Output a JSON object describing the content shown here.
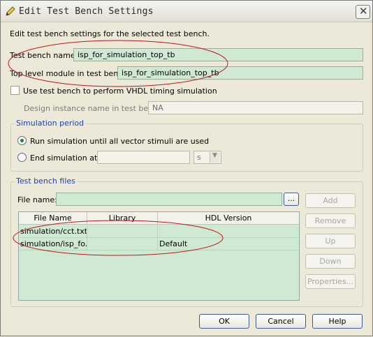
{
  "window": {
    "title": "Edit Test Bench Settings",
    "close_glyph": "✕"
  },
  "description": "Edit test bench settings for the selected test bench.",
  "test_bench_name": {
    "label": "Test bench name:",
    "value": "isp_for_simulation_top_tb"
  },
  "top_level_module": {
    "label": "Top level module in test bench:",
    "value": "isp_for_simulation_top_tb"
  },
  "vhdl_timing": {
    "label": "Use test bench to perform VHDL timing simulation",
    "checked": false
  },
  "design_instance": {
    "label": "Design instance name in test bench:",
    "value": "NA"
  },
  "simulation_period": {
    "title": "Simulation period",
    "run_all_label": "Run simulation until all vector stimuli are used",
    "end_at_label": "End simulation at:",
    "end_at_value": "",
    "unit_value": "s",
    "selected": "run_all"
  },
  "test_bench_files": {
    "title": "Test bench files",
    "file_name_label": "File name:",
    "file_name_value": "",
    "browse_label": "...",
    "columns": [
      "File Name",
      "Library",
      "HDL Version"
    ],
    "rows": [
      {
        "file": "simulation/cct.txt",
        "library": "",
        "hdl": ""
      },
      {
        "file": "simulation/isp_fo...",
        "library": "",
        "hdl": "Default"
      }
    ],
    "buttons": {
      "add": "Add",
      "remove": "Remove",
      "up": "Up",
      "down": "Down",
      "properties": "Properties..."
    }
  },
  "footer": {
    "ok": "OK",
    "cancel": "Cancel",
    "help": "Help"
  },
  "colors": {
    "field_green": "#CFE9D3",
    "annotation_red": "#C0141E",
    "group_title_blue": "#1E3FAF"
  },
  "icons": {
    "title": "pencil-icon",
    "close": "close-icon",
    "dropdown": "chevron-down-icon"
  }
}
